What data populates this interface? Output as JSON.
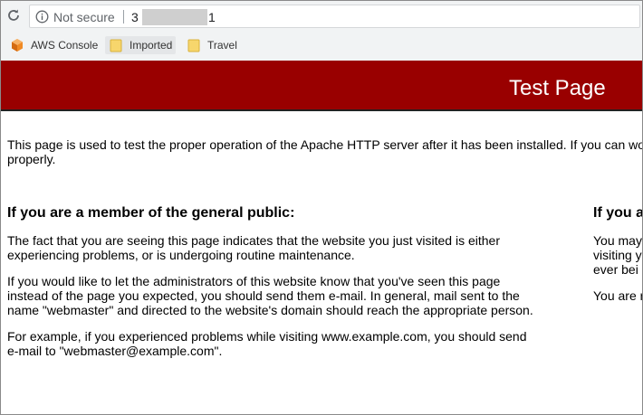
{
  "browser": {
    "security_label": "Not secure",
    "url_prefix": "3",
    "url_suffix": "1",
    "bookmarks": [
      {
        "label": "AWS Console",
        "icon": "aws-cube-icon"
      },
      {
        "label": "Imported",
        "icon": "folder-icon"
      },
      {
        "label": "Travel",
        "icon": "folder-icon"
      }
    ],
    "colors": {
      "chrome": "#f1f3f4",
      "folder": "#f7d66c",
      "aws": "#f08a24"
    }
  },
  "page": {
    "banner_title": "Test Page",
    "banner_color": "#990000",
    "intro": "This page is used to test the proper operation of the Apache HTTP server after it has been installed. If you can working properly.",
    "left": {
      "heading": "If you are a member of the general public:",
      "paragraphs": [
        "The fact that you are seeing this page indicates that the website you just visited is either experiencing problems, or is undergoing routine maintenance.",
        "If you would like to let the administrators of this website know that you've seen this page instead of the page you expected, you should send them e-mail. In general, mail sent to the name \"webmaster\" and directed to the website's domain should reach the appropriate person.",
        "For example, if you experienced problems while visiting www.example.com, you should send e-mail to \"webmaster@example.com\"."
      ]
    },
    "right": {
      "heading": "If you a",
      "paragraphs": [
        "You may\nvisiting y\never bei",
        "You are r"
      ]
    }
  }
}
